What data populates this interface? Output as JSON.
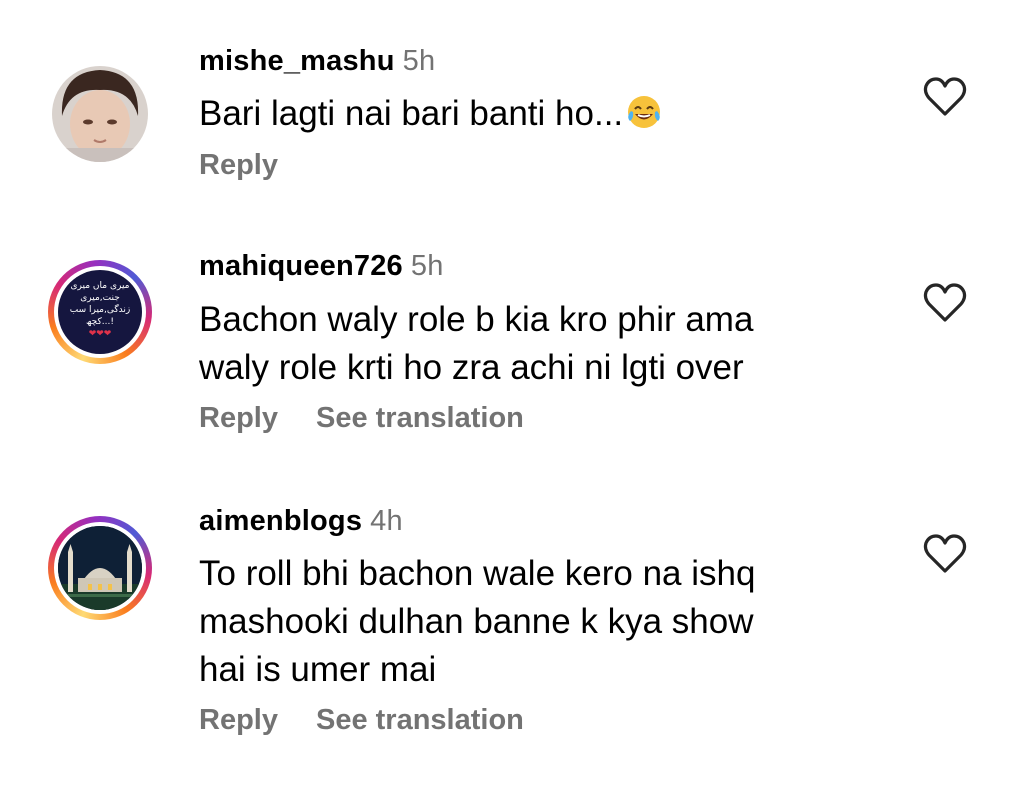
{
  "comments": [
    {
      "username": "mishe_mashu",
      "time": "5h",
      "lines": [
        "Bari lagti nai bari banti ho..."
      ],
      "emoji": "😂",
      "reply_label": "Reply",
      "translation_label": null
    },
    {
      "username": "mahiqueen726",
      "time": "5h",
      "lines": [
        "Bachon waly role b kia kro phir ama",
        "waly role krti ho zra achi ni lgti over"
      ],
      "avatar_text": [
        "میری ماں میری",
        "جنت,میری",
        "زندگی,میرا سب",
        "کچھ...!"
      ],
      "avatar_hearts": "❤❤❤",
      "reply_label": "Reply",
      "translation_label": "See translation"
    },
    {
      "username": "aimenblogs",
      "time": "4h",
      "lines": [
        "To roll bhi bachon wale kero na ishq",
        "mashooki dulhan banne k kya show",
        "hai is umer mai"
      ],
      "reply_label": "Reply",
      "translation_label": "See translation"
    }
  ],
  "colors": {
    "secondary_text": "#737373",
    "primary_text": "#000000",
    "story_ring": "#d62976"
  }
}
